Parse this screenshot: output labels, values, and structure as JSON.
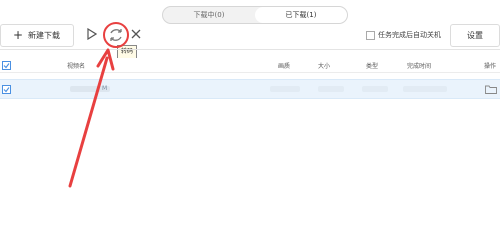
{
  "tabs": [
    {
      "label": "下载中(0)",
      "active": false
    },
    {
      "label": "已下载(1)",
      "active": true
    }
  ],
  "toolbar": {
    "new_download_label": "新建下载",
    "tooltip_label": "转码",
    "auto_shutdown_label": "任务完成后自动关机",
    "auto_shutdown_checked": false,
    "settings_label": "设置"
  },
  "table": {
    "columns": [
      "视频名",
      "画质",
      "大小",
      "类型",
      "完成时间",
      "操作"
    ],
    "rows": [
      {
        "name_suffix": "M",
        "selected": true
      }
    ]
  },
  "icons": {
    "play": "play-icon",
    "convert": "convert-icon",
    "delete": "close-icon",
    "open_folder": "folder-icon"
  },
  "colors": {
    "accent": "#4a90e2",
    "annotation": "#e84040",
    "selected_row": "#eaf3fc"
  }
}
